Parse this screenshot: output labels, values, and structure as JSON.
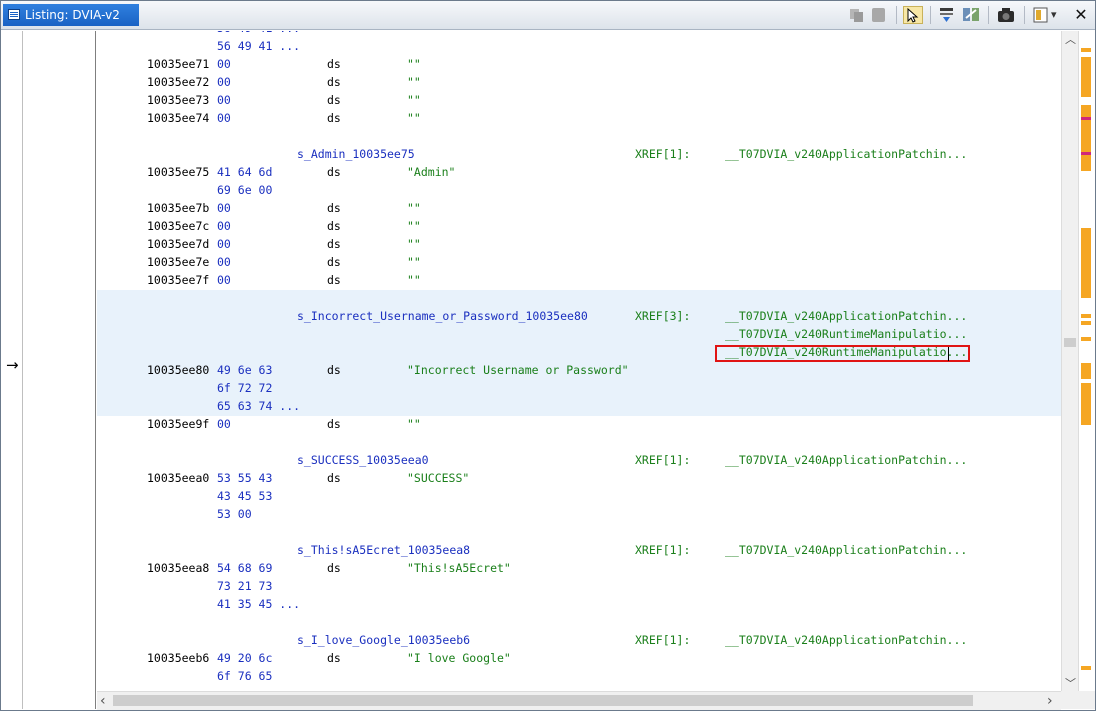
{
  "window": {
    "title": "Listing:  DVIA-v2"
  },
  "toolbar": {
    "icons": [
      "copy-icon",
      "paste-icon",
      "cursor-select-icon",
      "goto-next-icon",
      "diff-icon",
      "snapshot-icon",
      "layout-icon",
      "dropdown-icon",
      "close-icon"
    ],
    "close_glyph": "✕",
    "dropdown_glyph": "▾"
  },
  "gutter": {
    "arrow": "→"
  },
  "listing": {
    "top_lines": [
      {
        "bytes": "56 49 41 ..."
      },
      {
        "addr": "10035ee71",
        "bytes": "00",
        "mnem": "ds",
        "op": "\"\""
      },
      {
        "addr": "10035ee72",
        "bytes": "00",
        "mnem": "ds",
        "op": "\"\""
      },
      {
        "addr": "10035ee73",
        "bytes": "00",
        "mnem": "ds",
        "op": "\"\""
      },
      {
        "addr": "10035ee74",
        "bytes": "00",
        "mnem": "ds",
        "op": "\"\""
      }
    ],
    "admin": {
      "label": "s_Admin_10035ee75",
      "xref": "XREF[1]:",
      "xref_fn": "__T07DVIA_v240ApplicationPatchin...",
      "lines": [
        {
          "addr": "10035ee75",
          "bytes": "41 64 6d",
          "mnem": "ds",
          "op": "\"Admin\""
        },
        {
          "bytes": "69 6e 00"
        },
        {
          "addr": "10035ee7b",
          "bytes": "00",
          "mnem": "ds",
          "op": "\"\""
        },
        {
          "addr": "10035ee7c",
          "bytes": "00",
          "mnem": "ds",
          "op": "\"\""
        },
        {
          "addr": "10035ee7d",
          "bytes": "00",
          "mnem": "ds",
          "op": "\"\""
        },
        {
          "addr": "10035ee7e",
          "bytes": "00",
          "mnem": "ds",
          "op": "\"\""
        },
        {
          "addr": "10035ee7f",
          "bytes": "00",
          "mnem": "ds",
          "op": "\"\""
        }
      ]
    },
    "incorrect": {
      "label": "s_Incorrect_Username_or_Password_10035ee80",
      "xref": "XREF[3]:",
      "xref_fns": [
        "__T07DVIA_v240ApplicationPatchin...",
        "__T07DVIA_v240RuntimeManipulatio...",
        "__T07DVIA_v240RuntimeManipulatio..."
      ],
      "lines": [
        {
          "addr": "10035ee80",
          "bytes": "49 6e 63",
          "mnem": "ds",
          "op": "\"Incorrect Username or Password\""
        },
        {
          "bytes": "6f 72 72"
        },
        {
          "bytes": "65 63 74 ..."
        },
        {
          "addr": "10035ee9f",
          "bytes": "00",
          "mnem": "ds",
          "op": "\"\""
        }
      ]
    },
    "success": {
      "label": "s_SUCCESS_10035eea0",
      "xref": "XREF[1]:",
      "xref_fn": "__T07DVIA_v240ApplicationPatchin...",
      "lines": [
        {
          "addr": "10035eea0",
          "bytes": "53 55 43",
          "mnem": "ds",
          "op": "\"SUCCESS\""
        },
        {
          "bytes": "43 45 53"
        },
        {
          "bytes": "53 00"
        }
      ]
    },
    "secret": {
      "label": "s_This!sA5Ecret_10035eea8",
      "xref": "XREF[1]:",
      "xref_fn": "__T07DVIA_v240ApplicationPatchin...",
      "lines": [
        {
          "addr": "10035eea8",
          "bytes": "54 68 69",
          "mnem": "ds",
          "op": "\"This!sA5Ecret\""
        },
        {
          "bytes": "73 21 73"
        },
        {
          "bytes": "41 35 45 ..."
        }
      ]
    },
    "google": {
      "label": "s_I_love_Google_10035eeb6",
      "xref": "XREF[1]:",
      "xref_fn": "__T07DVIA_v240ApplicationPatchin...",
      "lines": [
        {
          "addr": "10035eeb6",
          "bytes": "49 20 6c",
          "mnem": "ds",
          "op": "\"I love Google\""
        },
        {
          "bytes": "6f 76 65"
        }
      ]
    }
  },
  "scrollbars": {
    "up": "︿",
    "down": "﹀",
    "left": "‹",
    "right": "›"
  },
  "colors": {
    "tab": "#1a62c4",
    "address_bytes": "#1a2fbf",
    "operand": "#1a7f1a",
    "selection": "#e8f2fb",
    "highlight_box": "#e01414",
    "overview": "#f5a623"
  }
}
